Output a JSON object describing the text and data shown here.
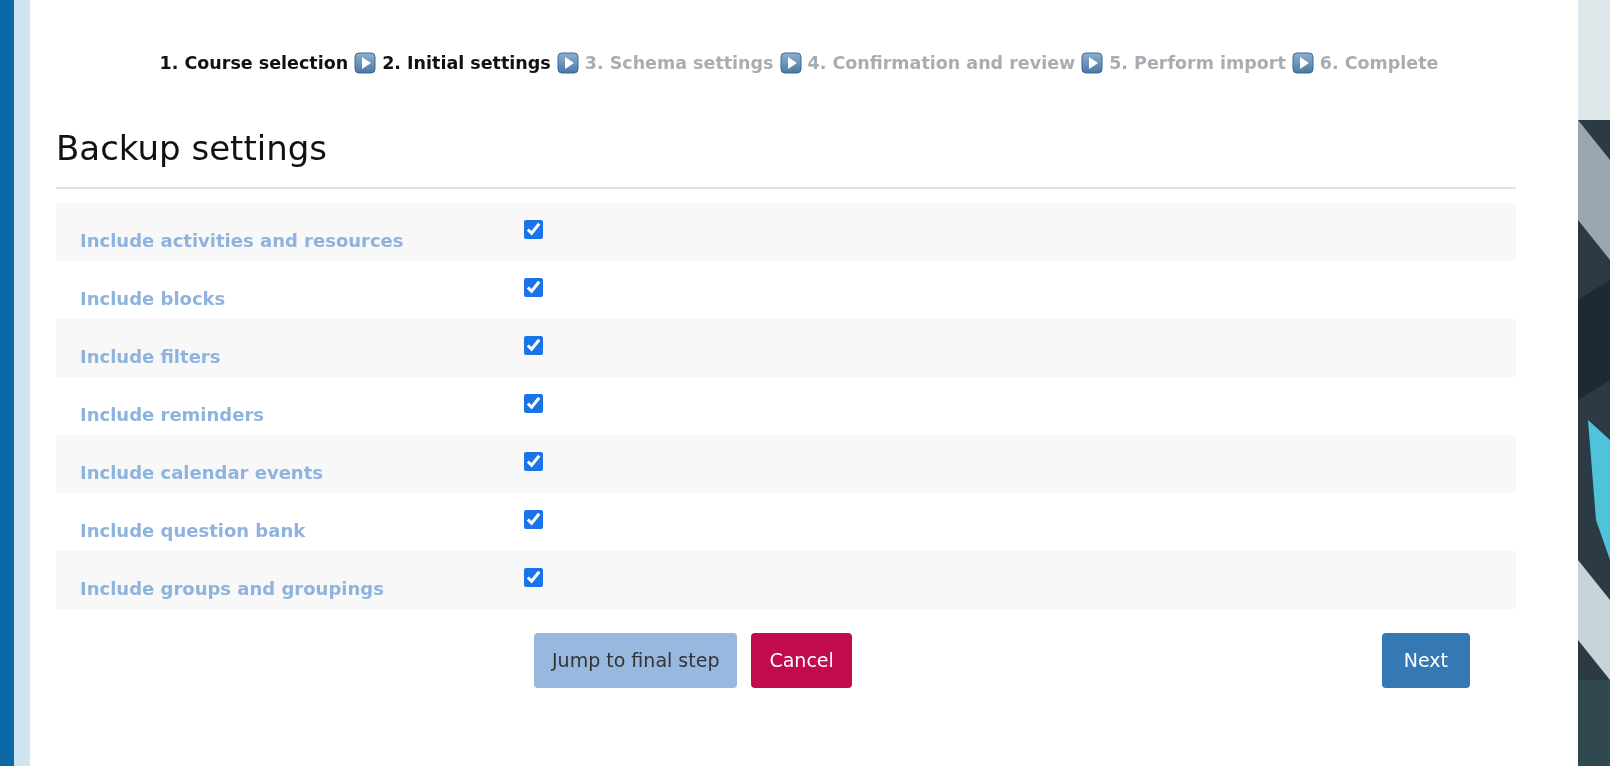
{
  "steps": [
    {
      "label": "1. Course selection",
      "completed": true
    },
    {
      "label": "2. Initial settings",
      "completed": true
    },
    {
      "label": "3. Schema settings",
      "completed": false
    },
    {
      "label": "4. Confirmation and review",
      "completed": false
    },
    {
      "label": "5. Perform import",
      "completed": false
    },
    {
      "label": "6. Complete",
      "completed": false
    }
  ],
  "heading": "Backup settings",
  "settings": [
    {
      "label": "Include activities and resources",
      "checked": true
    },
    {
      "label": "Include blocks",
      "checked": true
    },
    {
      "label": "Include filters",
      "checked": true
    },
    {
      "label": "Include reminders",
      "checked": true
    },
    {
      "label": "Include calendar events",
      "checked": true
    },
    {
      "label": "Include question bank",
      "checked": true
    },
    {
      "label": "Include groups and groupings",
      "checked": true
    }
  ],
  "buttons": [
    {
      "label": "Jump to final step",
      "kind": "secondary"
    },
    {
      "label": "Cancel",
      "kind": "danger"
    },
    {
      "label": "Next",
      "kind": "primary"
    }
  ]
}
